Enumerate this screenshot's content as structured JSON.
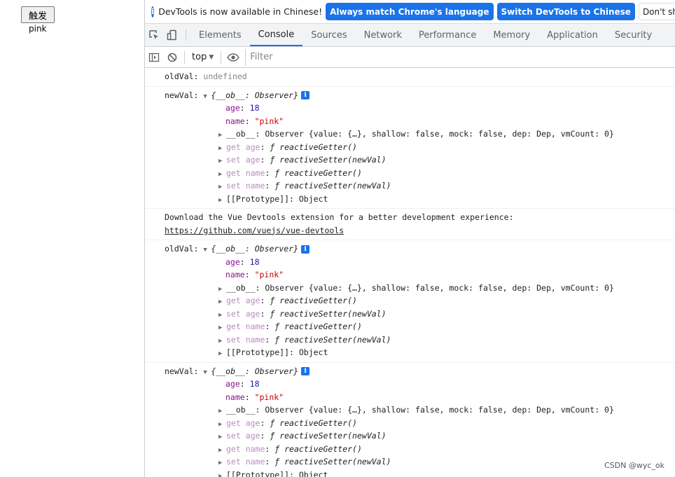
{
  "page": {
    "trigger_button": "触发",
    "value_text": "pink"
  },
  "infobar": {
    "message": "DevTools is now available in Chinese!",
    "btn_match": "Always match Chrome's language",
    "btn_switch": "Switch DevTools to Chinese",
    "btn_dont_show": "Don't show"
  },
  "tabs": [
    "Elements",
    "Console",
    "Sources",
    "Network",
    "Performance",
    "Memory",
    "Application",
    "Security"
  ],
  "toolbar": {
    "context": "top",
    "filter_placeholder": "Filter"
  },
  "console": {
    "first": {
      "label": "oldVal:",
      "value": "undefined"
    },
    "objects": [
      {
        "label": "newVal:"
      },
      {
        "label": "oldVal:"
      },
      {
        "label": "newVal:"
      }
    ],
    "object_summary": "{__ob__: Observer}",
    "age_key": "age",
    "age_value": "18",
    "name_key": "name",
    "name_value": "\"pink\"",
    "ob_line": "__ob__: Observer {value: {…}, shallow: false, mock: false, dep: Dep, vmCount: 0}",
    "get_age": "get age",
    "set_age": "set age",
    "get_name": "get name",
    "set_name": "set name",
    "getter_fn": "reactiveGetter()",
    "setter_fn": "reactiveSetter(newVal)",
    "prototype": "[[Prototype]]: Object",
    "download_msg": "Download the Vue Devtools extension for a better development experience:",
    "download_link": "https://github.com/vuejs/vue-devtools"
  },
  "watermark": "CSDN @wyc_ok"
}
